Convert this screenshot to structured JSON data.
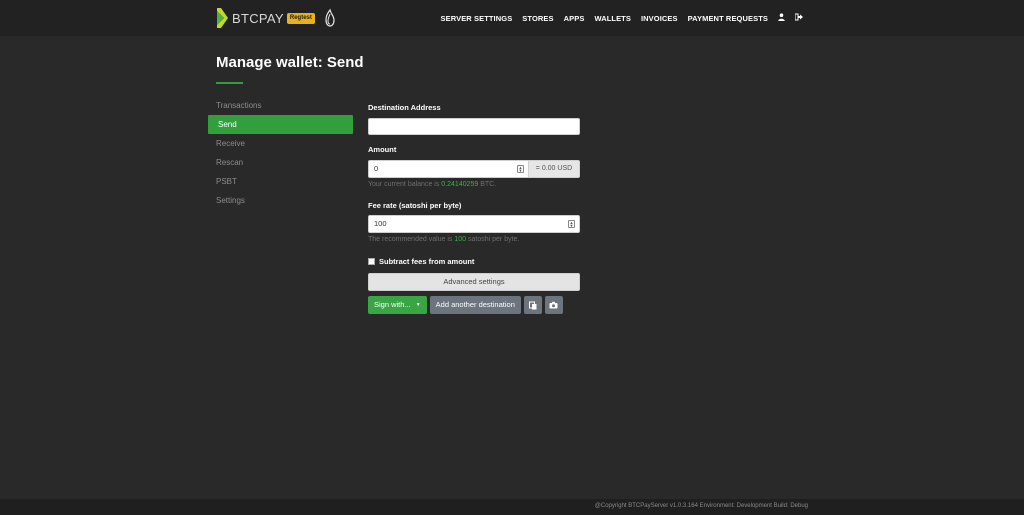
{
  "brand": {
    "name": "BTCPAY",
    "badge": "Regtest",
    "logo_icon": "btcpay-logo-icon",
    "tor_icon": "onion-icon",
    "badge_color": "#e8b21a"
  },
  "nav": {
    "items": [
      "SERVER SETTINGS",
      "STORES",
      "APPS",
      "WALLETS",
      "INVOICES",
      "PAYMENT REQUESTS"
    ],
    "user_icon": "user-icon",
    "logout_icon": "logout-icon"
  },
  "page": {
    "title": "Manage wallet: Send",
    "accent_color": "#329f3c"
  },
  "sidebar": {
    "items": [
      {
        "label": "Transactions",
        "active": false
      },
      {
        "label": "Send",
        "active": true
      },
      {
        "label": "Receive",
        "active": false
      },
      {
        "label": "Rescan",
        "active": false
      },
      {
        "label": "PSBT",
        "active": false
      },
      {
        "label": "Settings",
        "active": false
      }
    ]
  },
  "form": {
    "destination": {
      "label": "Destination Address",
      "value": ""
    },
    "amount": {
      "label": "Amount",
      "value": "0",
      "fiat": "= 0.00 USD",
      "help_prefix": "Your current balance is ",
      "balance": "0.24140259",
      "help_suffix": " BTC."
    },
    "fee": {
      "label": "Fee rate (satoshi per byte)",
      "value": "100",
      "help_prefix": "The recommended value is ",
      "recommended": "100",
      "help_suffix": " satoshi per byte."
    },
    "subtract_fees": {
      "label": "Subtract fees from amount",
      "checked": false
    },
    "advanced_button": "Advanced settings",
    "sign_button": "Sign with...",
    "add_destination_button": "Add another destination",
    "paste_icon": "paste-icon",
    "camera_icon": "camera-icon"
  },
  "footer": {
    "text": "@Copyright BTCPayServer v1.0.3.164 Environment: Development Build: Debug"
  }
}
